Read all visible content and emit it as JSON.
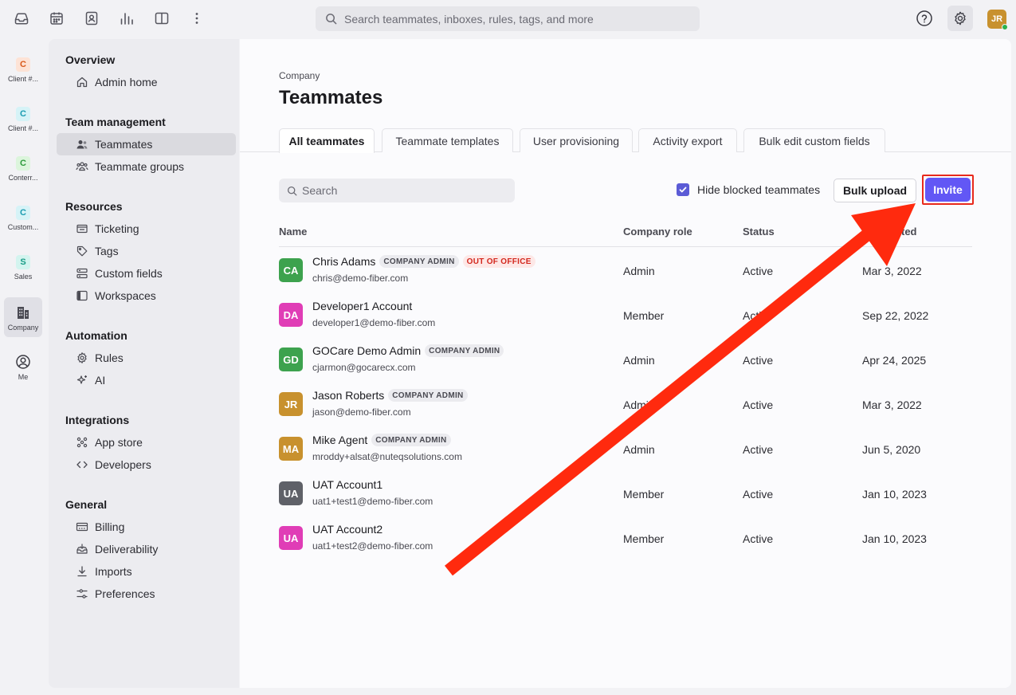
{
  "topbar": {
    "search_placeholder": "Search teammates, inboxes, rules, tags, and more",
    "avatar_initials": "JR",
    "icons": [
      "inbox-icon",
      "calendar-icon",
      "contacts-icon",
      "analytics-icon",
      "knowledge-base-icon",
      "more-icon",
      "help-icon",
      "settings-gear-icon"
    ]
  },
  "rail": {
    "items": [
      {
        "badge": "C",
        "label": "Client #...",
        "badge_color": "#fde3d6",
        "badge_text_color": "#d9591b"
      },
      {
        "badge": "C",
        "label": "Client #...",
        "badge_color": "#d6f3f7",
        "badge_text_color": "#1a9bb0"
      },
      {
        "badge": "C",
        "label": "Conterr...",
        "badge_color": "#dcf5dc",
        "badge_text_color": "#2b9a3a"
      },
      {
        "badge": "C",
        "label": "Custom...",
        "badge_color": "#d6f3f7",
        "badge_text_color": "#1a9bb0"
      },
      {
        "badge": "S",
        "label": "Sales",
        "badge_color": "#d3f4ef",
        "badge_text_color": "#199c86"
      }
    ],
    "company_label": "Company",
    "me_label": "Me"
  },
  "nav": {
    "sections": [
      {
        "title": "Overview",
        "items": [
          {
            "label": "Admin home",
            "icon": "home-icon"
          }
        ]
      },
      {
        "title": "Team management",
        "items": [
          {
            "label": "Teammates",
            "icon": "teammates-icon",
            "active": true
          },
          {
            "label": "Teammate groups",
            "icon": "teammate-groups-icon"
          }
        ]
      },
      {
        "title": "Resources",
        "items": [
          {
            "label": "Ticketing",
            "icon": "ticket-icon"
          },
          {
            "label": "Tags",
            "icon": "tag-icon"
          },
          {
            "label": "Custom fields",
            "icon": "custom-fields-icon"
          },
          {
            "label": "Workspaces",
            "icon": "workspaces-icon"
          }
        ]
      },
      {
        "title": "Automation",
        "items": [
          {
            "label": "Rules",
            "icon": "rules-gear-icon"
          },
          {
            "label": "AI",
            "icon": "ai-sparkle-icon"
          }
        ]
      },
      {
        "title": "Integrations",
        "items": [
          {
            "label": "App store",
            "icon": "app-store-icon"
          },
          {
            "label": "Developers",
            "icon": "code-icon"
          }
        ]
      },
      {
        "title": "General",
        "items": [
          {
            "label": "Billing",
            "icon": "billing-icon"
          },
          {
            "label": "Deliverability",
            "icon": "deliverability-icon"
          },
          {
            "label": "Imports",
            "icon": "import-icon"
          },
          {
            "label": "Preferences",
            "icon": "preferences-icon"
          }
        ]
      }
    ]
  },
  "page": {
    "eyebrow": "Company",
    "title": "Teammates",
    "tabs": [
      "All teammates",
      "Teammate templates",
      "User provisioning",
      "Activity export",
      "Bulk edit custom fields"
    ],
    "search_placeholder": "Search",
    "hide_blocked_label": "Hide blocked teammates",
    "hide_blocked_checked": true,
    "bulk_upload_label": "Bulk upload",
    "invite_label": "Invite",
    "accent_color": "#6257f5"
  },
  "table": {
    "columns": [
      "Name",
      "Company role",
      "Status",
      "ted"
    ],
    "rows": [
      {
        "initials": "CA",
        "color": "#3da24e",
        "name": "Chris Adams",
        "tags": [
          "COMPANY ADMIN",
          "OUT OF OFFICE"
        ],
        "email": "chris@demo-fiber.com",
        "role": "Admin",
        "status": "Active",
        "date": "Mar 3, 2022"
      },
      {
        "initials": "DA",
        "color": "#e03db6",
        "name": "Developer1 Account",
        "tags": [],
        "email": "developer1@demo-fiber.com",
        "role": "Member",
        "status": "Active",
        "date": "Sep 22, 2022"
      },
      {
        "initials": "GD",
        "color": "#3da24e",
        "name": "GOCare Demo Admin",
        "tags": [
          "COMPANY ADMIN"
        ],
        "email": "cjarmon@gocarecx.com",
        "role": "Admin",
        "status": "Active",
        "date": "Apr 24, 2025"
      },
      {
        "initials": "JR",
        "color": "#c8912e",
        "name": "Jason Roberts",
        "tags": [
          "COMPANY ADMIN"
        ],
        "email": "jason@demo-fiber.com",
        "role": "Admin",
        "status": "Active",
        "date": "Mar 3, 2022"
      },
      {
        "initials": "MA",
        "color": "#c8912e",
        "name": "Mike Agent",
        "tags": [
          "COMPANY ADMIN"
        ],
        "email": "mroddy+alsat@nuteqsolutions.com",
        "role": "Admin",
        "status": "Active",
        "date": "Jun 5, 2020"
      },
      {
        "initials": "UA",
        "color": "#5f6168",
        "name": "UAT Account1",
        "tags": [],
        "email": "uat1+test1@demo-fiber.com",
        "role": "Member",
        "status": "Active",
        "date": "Jan 10, 2023"
      },
      {
        "initials": "UA",
        "color": "#e03db6",
        "name": "UAT Account2",
        "tags": [],
        "email": "uat1+test2@demo-fiber.com",
        "role": "Member",
        "status": "Active",
        "date": "Jan 10, 2023"
      }
    ]
  },
  "annotation": {
    "arrow_color": "#ff2a0e",
    "highlight_color": "#e8291c"
  }
}
